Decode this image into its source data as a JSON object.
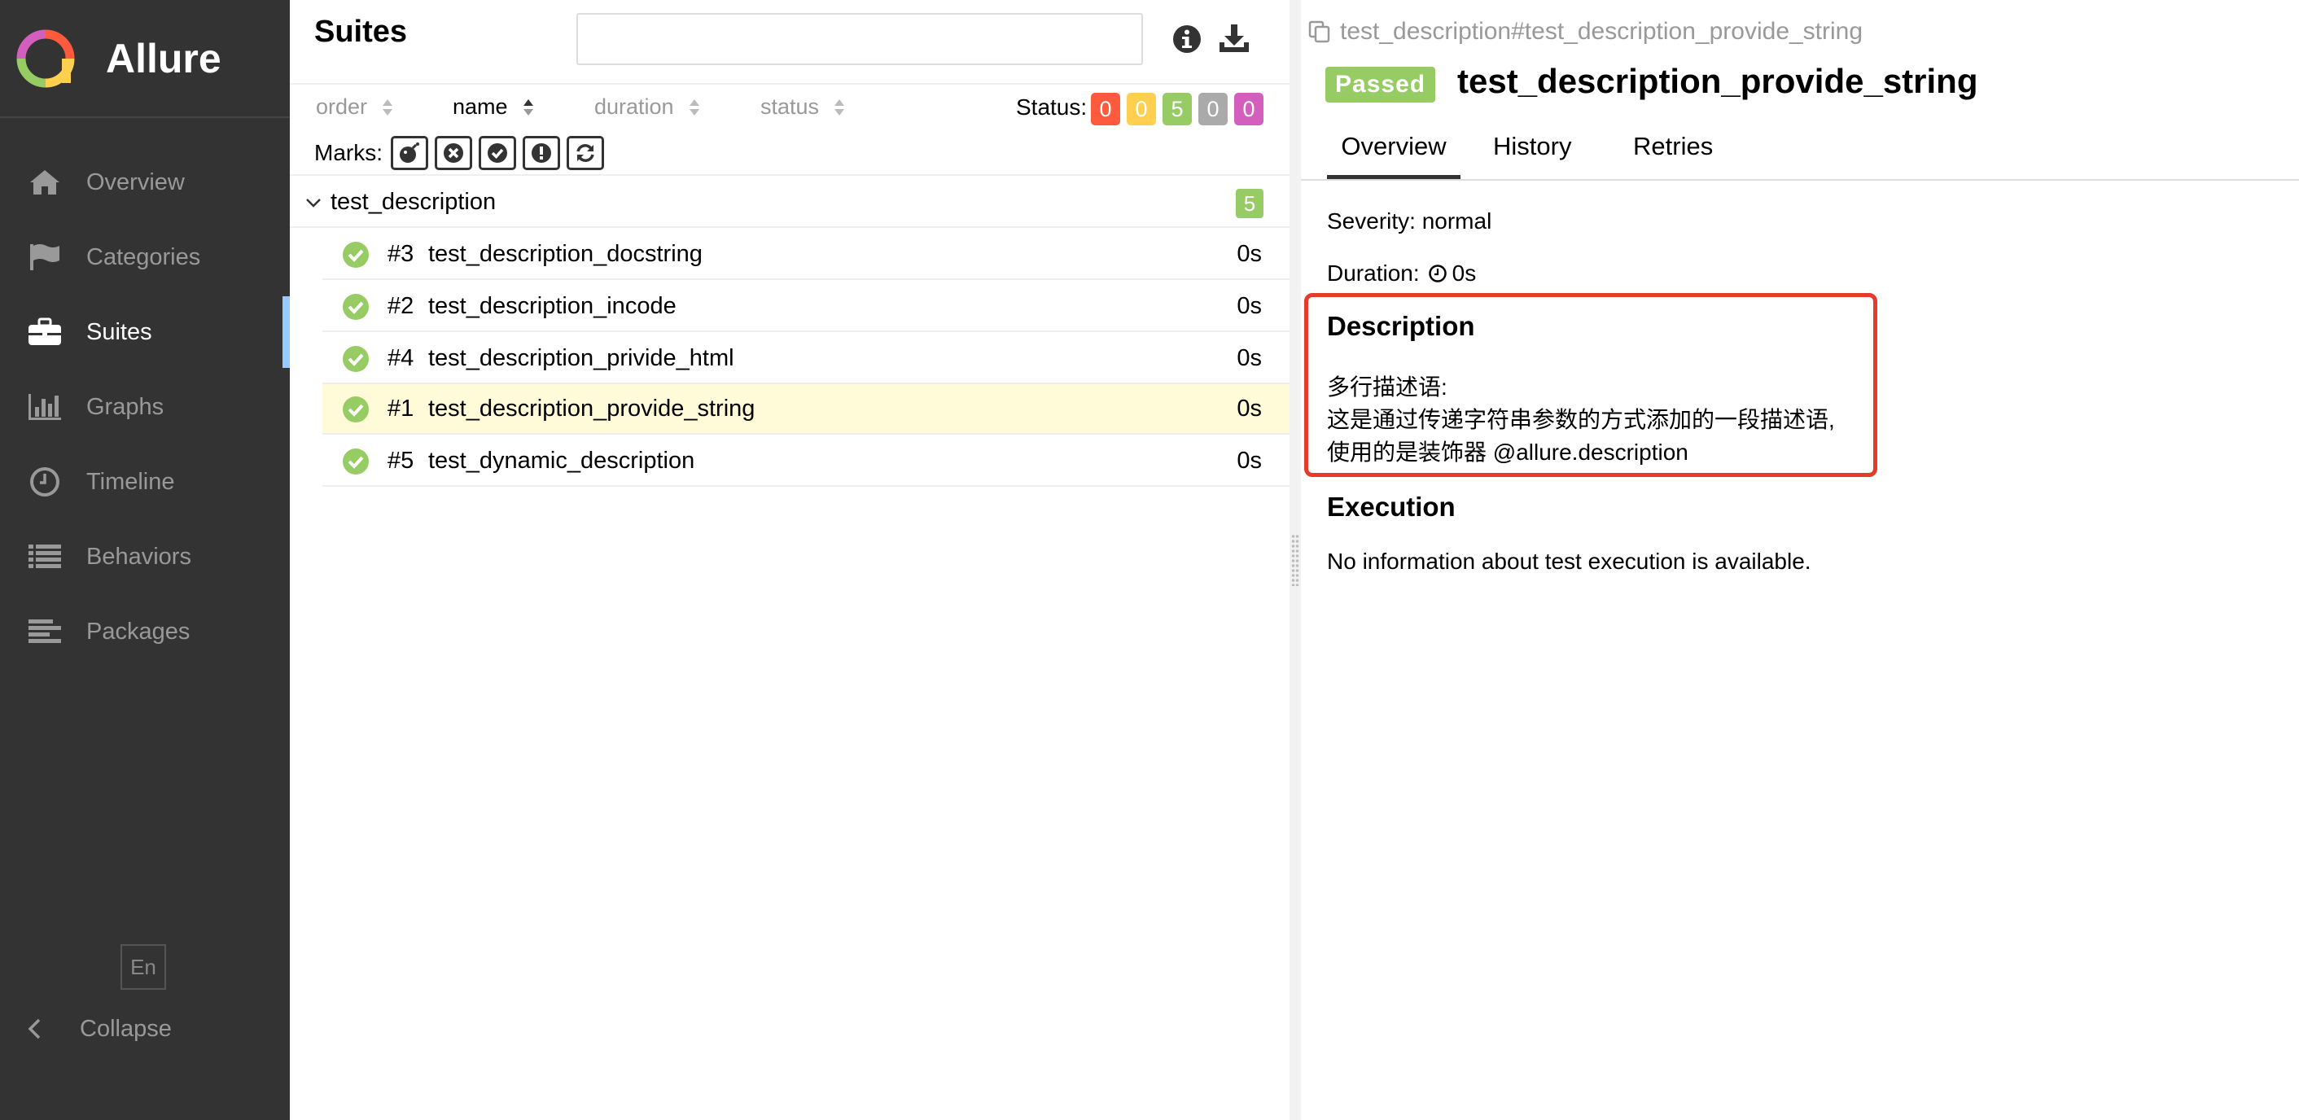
{
  "sidebar": {
    "brand": "Allure",
    "items": [
      {
        "label": "Overview",
        "icon": "home-icon"
      },
      {
        "label": "Categories",
        "icon": "flag-icon"
      },
      {
        "label": "Suites",
        "icon": "briefcase-icon",
        "active": true
      },
      {
        "label": "Graphs",
        "icon": "bar-chart-icon"
      },
      {
        "label": "Timeline",
        "icon": "clock-icon"
      },
      {
        "label": "Behaviors",
        "icon": "list-icon"
      },
      {
        "label": "Packages",
        "icon": "align-left-icon"
      }
    ],
    "language": "En",
    "collapse": "Collapse"
  },
  "suites": {
    "title": "Suites",
    "search_value": "",
    "sorters": [
      {
        "label": "order"
      },
      {
        "label": "name",
        "active": true
      },
      {
        "label": "duration"
      },
      {
        "label": "status"
      }
    ],
    "status_label": "Status:",
    "status_counts": [
      {
        "value": "0",
        "color": "#fd5a3e"
      },
      {
        "value": "0",
        "color": "#ffd050"
      },
      {
        "value": "5",
        "color": "#97cc64"
      },
      {
        "value": "0",
        "color": "#aaaaaa"
      },
      {
        "value": "0",
        "color": "#d35ebe"
      }
    ],
    "marks_label": "Marks:",
    "marks": [
      "bomb-icon",
      "times-circle-icon",
      "check-circle-icon",
      "exclamation-circle-icon",
      "refresh-icon"
    ],
    "group": {
      "name": "test_description",
      "count": "5"
    },
    "tests": [
      {
        "num": "#3",
        "name": "test_description_docstring",
        "duration": "0s"
      },
      {
        "num": "#2",
        "name": "test_description_incode",
        "duration": "0s"
      },
      {
        "num": "#4",
        "name": "test_description_privide_html",
        "duration": "0s"
      },
      {
        "num": "#1",
        "name": "test_description_provide_string",
        "duration": "0s",
        "selected": true
      },
      {
        "num": "#5",
        "name": "test_dynamic_description",
        "duration": "0s"
      }
    ]
  },
  "detail": {
    "breadcrumb": "test_description#test_description_provide_string",
    "status": "Passed",
    "title": "test_description_provide_string",
    "tabs": [
      "Overview",
      "History",
      "Retries"
    ],
    "severity": "Severity: normal",
    "duration_label": "Duration:",
    "duration_value": "0s",
    "description_title": "Description",
    "description_lines": [
      "多行描述语:",
      "这是通过传递字符串参数的方式添加的一段描述语,",
      "使用的是装饰器 @allure.description"
    ],
    "execution_title": "Execution",
    "execution_text": "No information about test execution is available."
  }
}
